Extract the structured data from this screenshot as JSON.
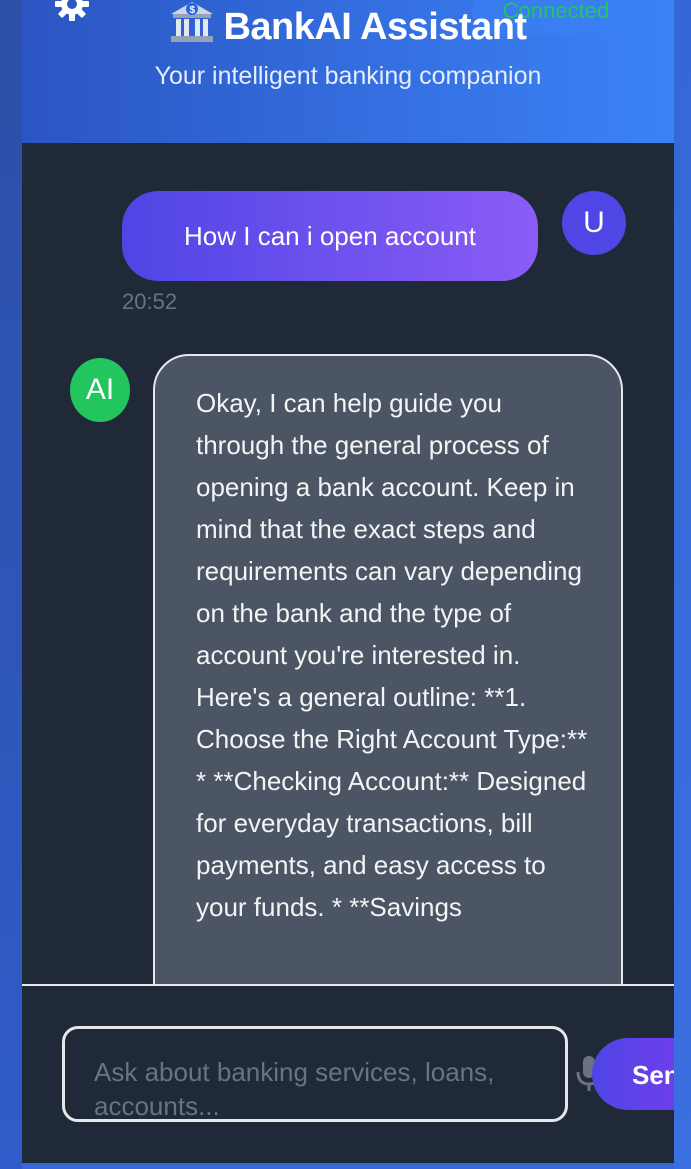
{
  "header": {
    "title": "BankAI Assistant",
    "subtitle": "Your intelligent banking companion",
    "status": "Connected",
    "icons": {
      "settings": "gear-icon",
      "logo": "bank-icon"
    }
  },
  "messages": [
    {
      "role": "user",
      "avatar": "U",
      "text": "How I can i open account",
      "time": "20:52"
    },
    {
      "role": "assistant",
      "avatar": "AI",
      "text": "Okay, I can help guide you through the general process of opening a bank account. Keep in mind that the exact steps and requirements can vary depending on the bank and the type of account you're interested in. Here's a general outline: **1. Choose the Right Account Type:** * **Checking Account:** Designed for everyday transactions, bill payments, and easy access to your funds. * **Savings"
    }
  ],
  "composer": {
    "placeholder": "Ask about banking services, loans, accounts...",
    "send_label": "Send",
    "mic_icon": "microphone-icon"
  },
  "colors": {
    "accent": "#4f46e5",
    "accent_end": "#8b5cf6",
    "ai_avatar": "#22c55e",
    "status_text": "#22c55e",
    "chat_bg": "#1f2937",
    "ai_bubble": "#4b5563",
    "header_end": "#3b82f6"
  }
}
